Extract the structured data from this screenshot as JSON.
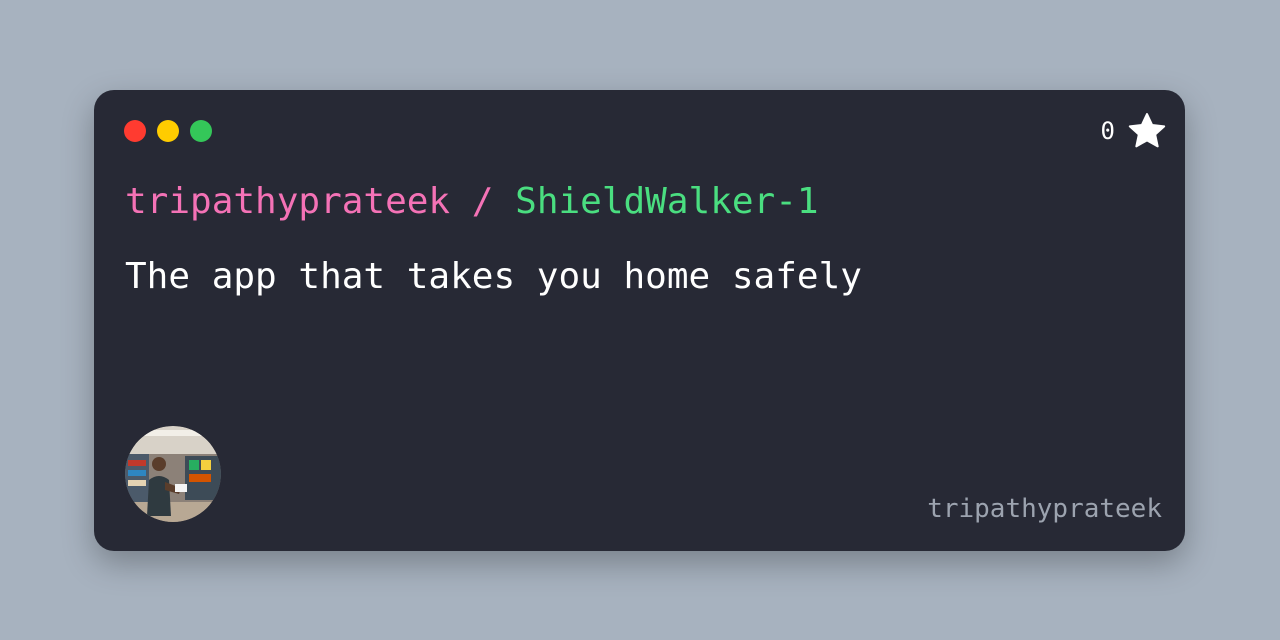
{
  "theme": {
    "background": "#a7b2bf",
    "card_background": "#272935",
    "owner_color": "#f472b6",
    "repo_color": "#4ade80",
    "separator_color": "#f472b6",
    "text_color": "#ffffff",
    "muted_color": "#9ca3af"
  },
  "window_controls": {
    "close_color": "#ff3b30",
    "minimize_color": "#ffcc00",
    "maximize_color": "#34c759"
  },
  "stars": {
    "count": "0",
    "icon": "star-icon"
  },
  "repo": {
    "owner": "tripathyprateek",
    "separator": " / ",
    "name": "ShieldWalker-1"
  },
  "description": "The app that takes you home safely",
  "author": {
    "avatar_icon": "avatar-photo",
    "username": "tripathyprateek"
  }
}
